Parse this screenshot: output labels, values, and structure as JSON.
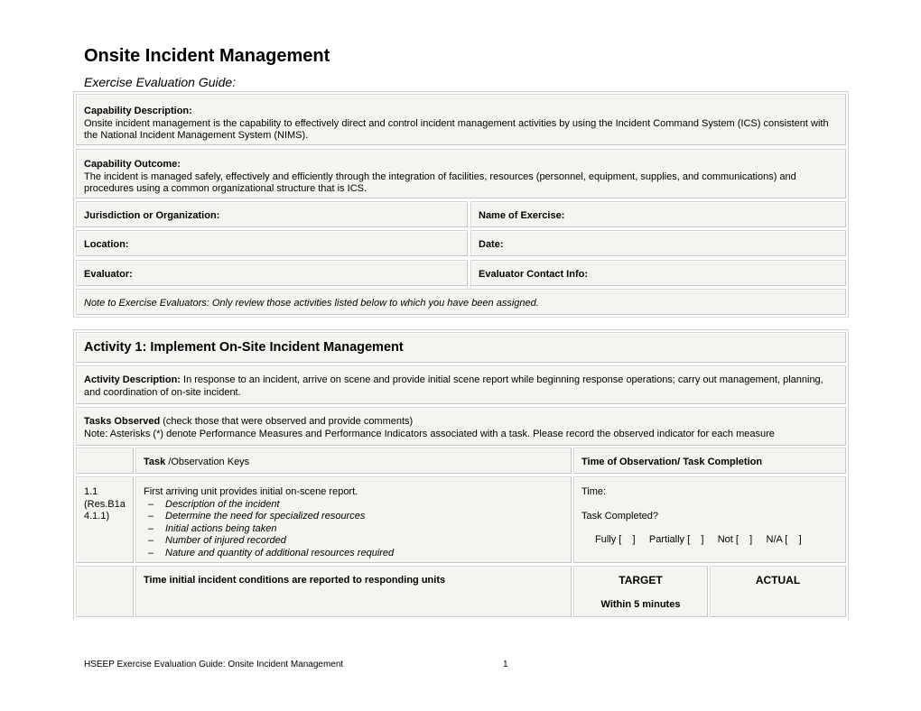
{
  "document": {
    "title": "Onsite Incident Management",
    "subtitle": "Exercise Evaluation Guide:"
  },
  "capability": {
    "description_label": "Capability Description:",
    "description_text": "Onsite incident management is the capability to effectively direct and control incident management activities by using the Incident Command System (ICS) consistent with the National Incident Management System (NIMS).",
    "outcome_label": "Capability Outcome:",
    "outcome_text": "The incident is managed safely, effectively and efficiently through the integration of facilities, resources (personnel, equipment, supplies, and communications) and procedures using a common organizational structure that is ICS."
  },
  "fields": {
    "jurisdiction": "Jurisdiction or Organization:",
    "exercise_name": "Name of Exercise:",
    "location": "Location:",
    "date": "Date:",
    "evaluator": "Evaluator:",
    "evaluator_contact": "Evaluator Contact Info:"
  },
  "note": "Note to Exercise Evaluators: Only review those activities listed below to which you have been assigned.",
  "activity": {
    "title": "Activity 1: Implement On-Site Incident Management",
    "description_label": "Activity Description:",
    "description_text": " In response to an incident, arrive on scene and provide initial scene report while beginning response operations; carry out management, planning, and coordination of on-site incident.",
    "tasks_label": "Tasks Observed",
    "tasks_hint": " (check those that were observed and provide comments)",
    "tasks_note": "Note: Asterisks (*) denote Performance Measures and Performance Indicators associated with a task. Please record the observed indicator for each measure"
  },
  "task_table": {
    "header_task_bold": "Task ",
    "header_task_rest": "/Observation Keys",
    "header_time": "Time of Observation/ Task Completion",
    "rows": [
      {
        "id": "1.1 (Res.B1a 4.1.1)",
        "task": "First arriving unit provides initial on-scene report.",
        "keys": [
          "Description of the incident",
          "Determine the need for specialized resources",
          "Initial actions being taken",
          "Number of injured recorded",
          "Nature and quantity of additional resources required"
        ],
        "time_label": "Time:",
        "completed_label": "Task Completed?",
        "options": [
          "Fully [    ]",
          "Partially [    ]",
          "Not [    ]",
          "N/A [    ]"
        ]
      }
    ],
    "measure": {
      "text": "Time initial incident conditions are reported to responding units",
      "target_label": "TARGET",
      "target_value": "Within 5 minutes",
      "actual_label": "ACTUAL"
    }
  },
  "footer": {
    "text": "HSEEP Exercise Evaluation Guide: Onsite Incident Management",
    "page": "1"
  }
}
